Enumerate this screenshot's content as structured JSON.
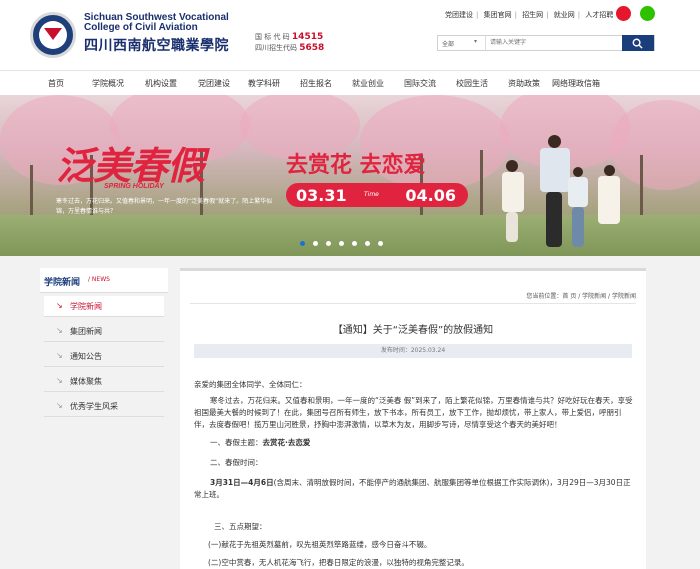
{
  "header": {
    "school_en": "Sichuan Southwest Vocational College of Civil Aviation",
    "school_cn": "四川西南航空職業學院",
    "code_label_1": "国 标 代 码",
    "code_value_1": "14515",
    "code_label_2": "四川招生代码",
    "code_value_2": "5658",
    "top_links": [
      "党团建设",
      "集团官网",
      "招生网",
      "就业网",
      "人才招聘"
    ],
    "search_select": "全部",
    "search_placeholder": "请输入关键字"
  },
  "nav": [
    "首页",
    "学院概况",
    "机构设置",
    "党团建设",
    "教学科研",
    "招生报名",
    "就业创业",
    "国际交流",
    "校园生活",
    "资助政策",
    "网络理政信箱"
  ],
  "banner": {
    "title": "泛美春假",
    "subtitle": "SPRING HOLIDAY",
    "slogan": "去赏花 去恋爱",
    "date_start": "03.31",
    "date_mid": "Time",
    "date_end": "04.06",
    "text": "寒冬过去，万花归来。又值春和景明，一年一度的“泛美春假”就来了。陌上繁华似锦，万里春情谁与共？",
    "dots_count": 7,
    "active_dot": 0
  },
  "sidebar": {
    "title": "学院新闻",
    "title_en": "/ NEWS",
    "items": [
      "学院新闻",
      "集团新闻",
      "通知公告",
      "媒体聚焦",
      "优秀学生风采"
    ],
    "active": 0
  },
  "article": {
    "breadcrumb": "您当前位置：首 页  /  学院新闻  /  学院新闻",
    "title": "【通知】关于“泛美春假”的放假通知",
    "meta": "发布时间：2025.03.24",
    "greeting": "亲爱的集团全体同学、全体同仁：",
    "intro": "寒冬过去，万花归来。又值春和景明，一年一度的“泛美春 假”到来了，陌上繁花似锦，万里春情谁与共？好吃好玩在春天，享受祖国最美大餐的时候到了！在此，集团号召所有师生，放下书本，所有员工，放下工作，抛却烦忧，带上家人，带上爱侣，呼朋引伴，去度春假吧！揽万里山河胜景，抒胸中澎湃激情，以草木为友，用脚步写诗，尽情享受这个春天的美好吧！",
    "s1_label": "一、春假主题：",
    "s1_value": "去赏花·去恋爱",
    "s2_label": "二、春假时间：",
    "s2_bold": "3月31日—4月6日",
    "s2_rest": "(含周末、清明放假时间，不能停产的通航集团、航服集团等单位根据工作实际调休)，3月29日—3月30日正常上班。",
    "s3_label": "三、五点期望：",
    "s3_item1": "(一)献花于先祖英烈墓前，叹先祖英烈筚路蓝缕，感今日奋斗不辍。",
    "s3_item2": "(二)空中赏春，无人机花海飞行，把春日限定的浪漫，以独特的视角完整记录。"
  }
}
